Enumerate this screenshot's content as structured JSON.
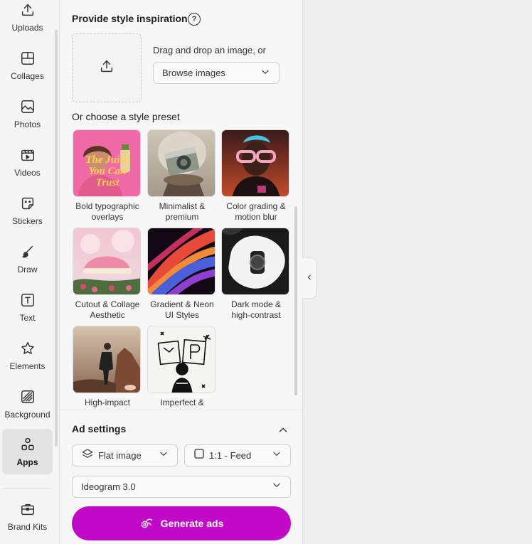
{
  "rail": {
    "items": [
      {
        "label": "Uploads",
        "icon": "upload-icon"
      },
      {
        "label": "Collages",
        "icon": "collage-icon"
      },
      {
        "label": "Photos",
        "icon": "photo-icon"
      },
      {
        "label": "Videos",
        "icon": "video-icon"
      },
      {
        "label": "Stickers",
        "icon": "sticker-icon"
      },
      {
        "label": "Draw",
        "icon": "brush-icon"
      },
      {
        "label": "Text",
        "icon": "text-icon"
      },
      {
        "label": "Elements",
        "icon": "star-icon"
      },
      {
        "label": "Background",
        "icon": "background-icon"
      },
      {
        "label": "Apps",
        "icon": "apps-icon",
        "active": true
      },
      {
        "label": "Brand Kits",
        "icon": "briefcase-icon"
      }
    ]
  },
  "inspiration": {
    "title": "Provide style inspiration",
    "help_glyph": "?",
    "drag_text": "Drag and drop an image, or",
    "browse_label": "Browse images"
  },
  "presets": {
    "title": "Or choose a style preset",
    "items": [
      {
        "line1": "Bold typographic",
        "line2": "overlays",
        "thumb_text": [
          "The Juice",
          "You Can",
          "Trust"
        ]
      },
      {
        "line1": "Minimalist &",
        "line2": "premium"
      },
      {
        "line1": "Color grading &",
        "line2": "motion blur"
      },
      {
        "line1": "Cutout & Collage",
        "line2": "Aesthetic"
      },
      {
        "line1": "Gradient & Neon",
        "line2": "UI Styles"
      },
      {
        "line1": "Dark mode &",
        "line2": "high-contrast"
      },
      {
        "line1": "High-impact",
        "line2": ""
      },
      {
        "line1": "Imperfect &",
        "line2": ""
      }
    ]
  },
  "ad_settings": {
    "title": "Ad settings",
    "format_label": "Flat image",
    "ratio_label": "1:1 - Feed",
    "model_label": "Ideogram 3.0",
    "generate_label": "Generate ads"
  },
  "colors": {
    "accent": "#c10ac7",
    "panel_bg": "#f7f7f7",
    "canvas_bg": "#eeeeee"
  }
}
